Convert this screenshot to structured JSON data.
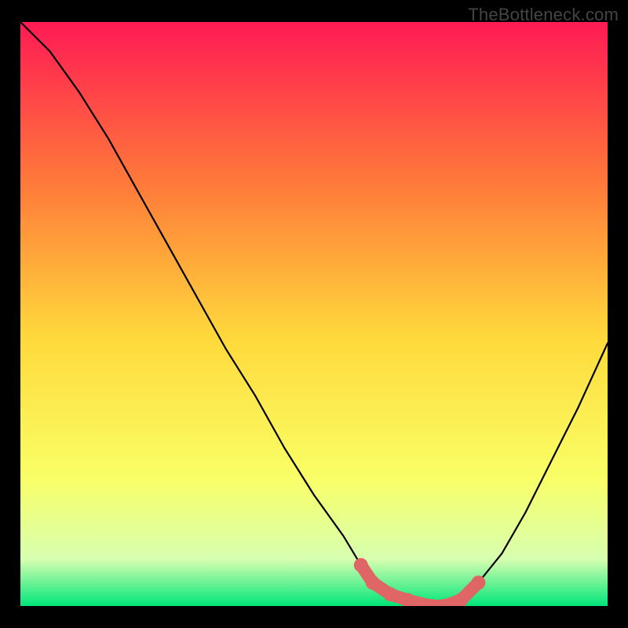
{
  "watermark": "TheBottleneck.com",
  "colors": {
    "background": "#000000",
    "gradient_top": "#ff1a54",
    "gradient_mid_upper": "#ff7b3a",
    "gradient_mid": "#ffd93b",
    "gradient_mid_lower": "#f9ff66",
    "gradient_lower": "#d7ffb0",
    "gradient_bottom": "#00e57a",
    "curve": "#000000",
    "marker": "#e06666"
  },
  "chart_data": {
    "type": "line",
    "title": "",
    "xlabel": "",
    "ylabel": "",
    "xlim": [
      0,
      100
    ],
    "ylim": [
      0,
      100
    ],
    "series": [
      {
        "name": "bottleneck-curve",
        "x": [
          0,
          5,
          10,
          15,
          20,
          25,
          30,
          35,
          40,
          45,
          50,
          55,
          58,
          60,
          63,
          66,
          70,
          72,
          75,
          78,
          82,
          86,
          90,
          95,
          100
        ],
        "values": [
          100,
          95,
          88,
          80,
          71,
          62,
          53,
          44,
          36,
          27,
          19,
          12,
          7,
          4,
          2,
          1,
          0,
          0,
          1,
          4,
          9,
          16,
          24,
          34,
          45
        ]
      }
    ],
    "markers": {
      "name": "optimal-region",
      "x": [
        58,
        60,
        63,
        66,
        70,
        72,
        75,
        78
      ],
      "values": [
        7,
        4,
        2,
        1,
        0,
        0,
        1,
        4
      ]
    }
  }
}
